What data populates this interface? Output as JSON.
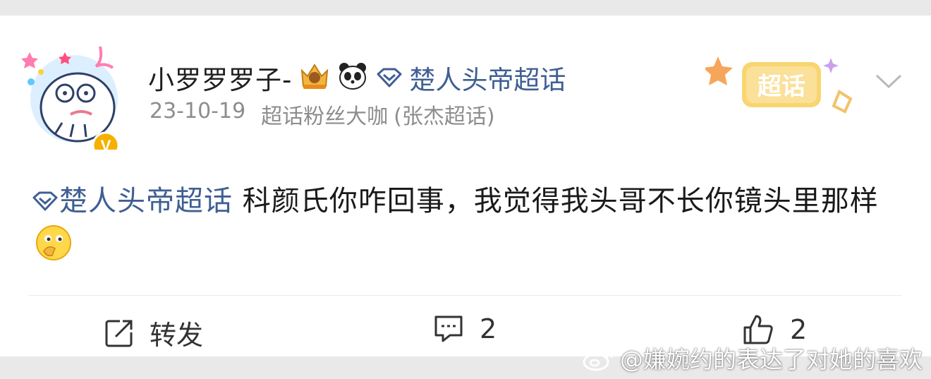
{
  "post": {
    "username": "小罗罗罗子-",
    "topic_tag": "楚人头帝超话",
    "date": "23-10-19",
    "fan_level": "超话粉丝大咖",
    "source": "(张杰超话)",
    "content_topic": "楚人头帝超话",
    "content_text": " 科颜氏你咋回事，我觉得我头哥不长你镜头里那样",
    "chaohua_label": "超话"
  },
  "actions": {
    "repost_label": "转发",
    "comment_count": "2",
    "like_count": "2"
  },
  "watermark": {
    "text": "@嫌婉约的表达了对她的喜欢"
  },
  "colors": {
    "topic_blue": "#3f5f93",
    "meta_gray": "#8d8d8d",
    "vip_badge": "#f5b000"
  },
  "icons": [
    "avatar-image",
    "crown-badge-icon",
    "panda-icon",
    "diamond-icon",
    "chevron-down-icon",
    "repost-icon",
    "comment-icon",
    "like-icon",
    "thinking-emoji-icon",
    "weibo-logo-icon"
  ]
}
